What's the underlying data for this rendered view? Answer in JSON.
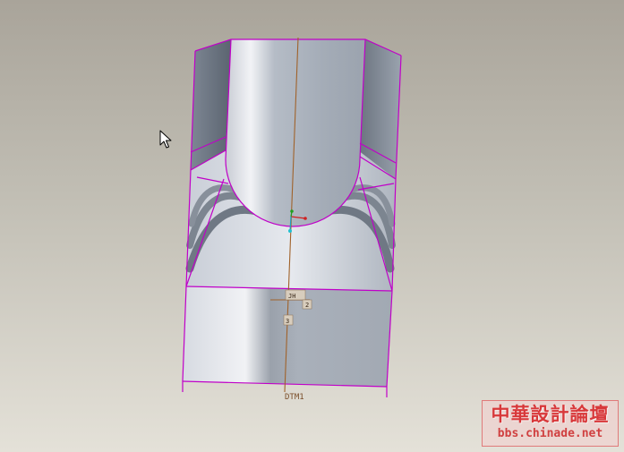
{
  "viewport": {
    "datum_label": "DTM1",
    "tag_upper": "JH",
    "tag_small_right": "2",
    "tag_small_left": "3",
    "colors": {
      "edge_highlight": "#c000c8",
      "datum_axis": "#a0622a",
      "model_face_light": "#dfe3ea",
      "model_face_dark": "#707986"
    }
  },
  "cursor": {
    "icon": "arrow-pointer"
  },
  "watermark": {
    "title": "中華設計論壇",
    "url": "bbs.chinade.net"
  }
}
